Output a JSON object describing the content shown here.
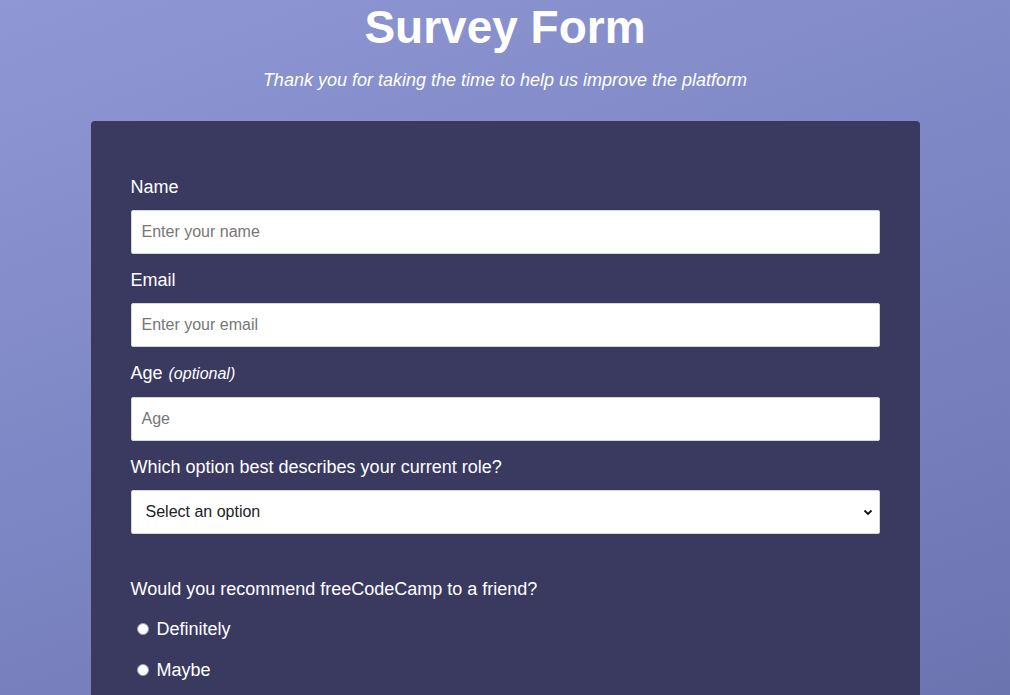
{
  "page": {
    "title": "Survey Form",
    "subtitle": "Thank you for taking the time to help us improve the platform"
  },
  "fields": [
    {
      "kind": "input",
      "label": "Name",
      "note": "",
      "placeholder": "Enter your name"
    },
    {
      "kind": "input",
      "label": "Email",
      "note": "",
      "placeholder": "Enter your email"
    },
    {
      "kind": "input",
      "label": "Age",
      "note": "(optional)",
      "placeholder": "Age"
    },
    {
      "kind": "select",
      "label": "Which option best describes your current role?",
      "note": "",
      "placeholder": "Select an option"
    }
  ],
  "radio_group": {
    "label": "Would you recommend freeCodeCamp to a friend?",
    "options": [
      {
        "label": "Definitely",
        "selected": false
      },
      {
        "label": "Maybe",
        "selected": false
      }
    ]
  }
}
